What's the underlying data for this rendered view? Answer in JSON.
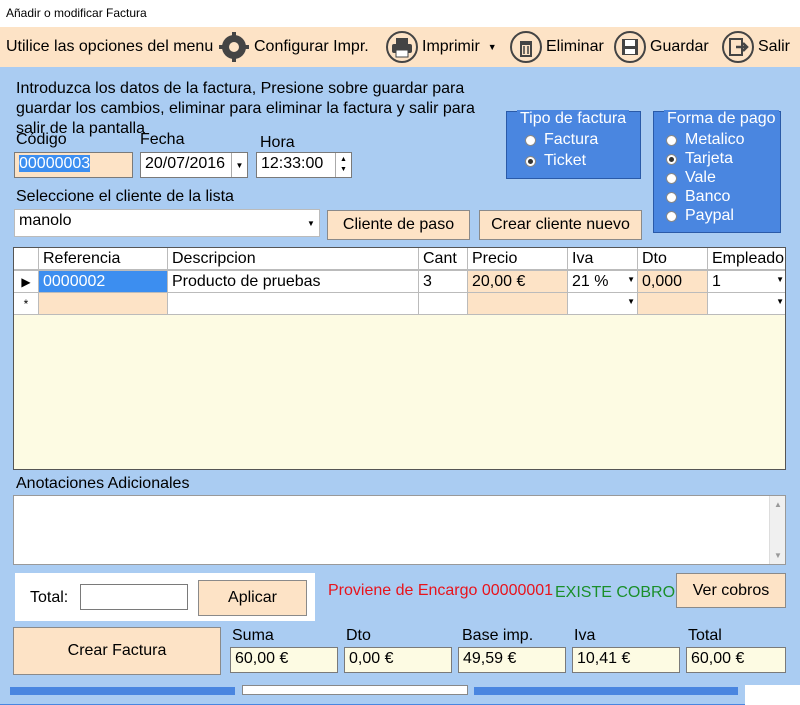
{
  "window": {
    "title": "Añadir o modificar Factura"
  },
  "menu": {
    "hint": "Utilice las opciones del menu",
    "configurar": "Configurar Impr.",
    "imprimir": "Imprimir",
    "eliminar": "Eliminar",
    "guardar": "Guardar",
    "salir": "Salir"
  },
  "instructions": "Introduzca los datos de la factura, Presione sobre guardar para guardar los cambios, eliminar para eliminar la factura y salir para salir de la pantalla",
  "form": {
    "codigo_label": "Código",
    "codigo_value": "00000003",
    "fecha_label": "Fecha",
    "fecha_value": "20/07/2016",
    "hora_label": "Hora",
    "hora_value": "12:33:00",
    "cliente_label": "Seleccione el cliente de la lista",
    "cliente_value": "manolo",
    "cliente_paso_button": "Cliente de paso",
    "crear_cliente_button": "Crear cliente nuevo"
  },
  "tipo_factura": {
    "title": "Tipo de factura",
    "options": [
      "Factura",
      "Ticket"
    ],
    "selected": "Ticket"
  },
  "forma_pago": {
    "title": "Forma de pago",
    "options": [
      "Metalico",
      "Tarjeta",
      "Vale",
      "Banco",
      "Paypal"
    ],
    "selected": "Tarjeta"
  },
  "table": {
    "headers": [
      "Referencia",
      "Descripcion",
      "Cant",
      "Precio",
      "Iva",
      "Dto",
      "Empleado"
    ],
    "rows": [
      {
        "marker": "▶",
        "referencia": "0000002",
        "descripcion": "Producto de pruebas",
        "cant": "3",
        "precio": "20,00 €",
        "iva": "21 %",
        "dto": "0,000",
        "empleado": "1"
      }
    ],
    "new_row_marker": "*"
  },
  "anotaciones": {
    "label": "Anotaciones Adicionales",
    "value": ""
  },
  "total_box": {
    "label": "Total:",
    "value": "",
    "aplicar_button": "Aplicar"
  },
  "status": {
    "encargo": "Proviene de Encargo 00000001",
    "cobro": "EXISTE COBRO",
    "ver_cobros_button": "Ver cobros",
    "encargo_color": "#e8141c",
    "cobro_color": "#1a8f2a"
  },
  "summary": {
    "crear_factura_button": "Crear Factura",
    "suma_label": "Suma",
    "suma_value": "60,00 €",
    "dto_label": "Dto",
    "dto_value": "0,00 €",
    "base_label": "Base imp.",
    "base_value": "49,59 €",
    "iva_label": "Iva",
    "iva_value": "10,41 €",
    "total_label": "Total",
    "total_value": "60,00 €"
  },
  "colors": {
    "background": "#aaccf2",
    "accent": "#fde3c6",
    "group": "#4a86e0",
    "grid": "#fdfbe3"
  }
}
